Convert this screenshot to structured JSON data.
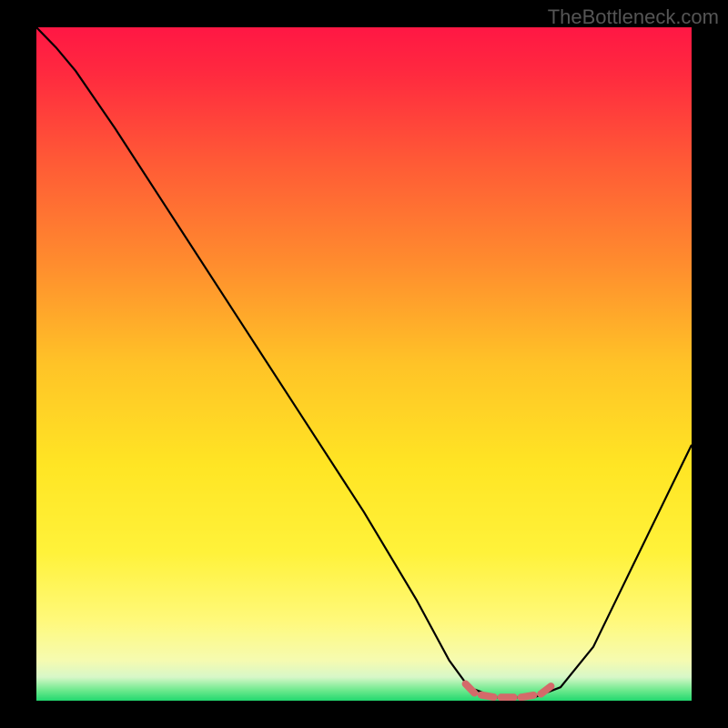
{
  "watermark": "TheBottleneck.com",
  "chart_data": {
    "type": "line",
    "title": "",
    "xlabel": "",
    "ylabel": "",
    "xlim": [
      0,
      100
    ],
    "ylim": [
      0,
      100
    ],
    "gradient_stops": [
      {
        "offset": 0.0,
        "color": "#ff1744"
      },
      {
        "offset": 0.07,
        "color": "#ff2a3f"
      },
      {
        "offset": 0.2,
        "color": "#ff5a36"
      },
      {
        "offset": 0.35,
        "color": "#ff8c2e"
      },
      {
        "offset": 0.5,
        "color": "#ffc327"
      },
      {
        "offset": 0.65,
        "color": "#ffe524"
      },
      {
        "offset": 0.78,
        "color": "#fff23a"
      },
      {
        "offset": 0.88,
        "color": "#fff97a"
      },
      {
        "offset": 0.94,
        "color": "#f6fbb0"
      },
      {
        "offset": 0.965,
        "color": "#d7f7c8"
      },
      {
        "offset": 0.985,
        "color": "#6be98c"
      },
      {
        "offset": 1.0,
        "color": "#22d86f"
      }
    ],
    "series": [
      {
        "name": "bottleneck-curve",
        "color": "#000000",
        "points": [
          {
            "x": 0.0,
            "y": 100.0
          },
          {
            "x": 3.0,
            "y": 97.0
          },
          {
            "x": 6.0,
            "y": 93.5
          },
          {
            "x": 12.0,
            "y": 85.0
          },
          {
            "x": 20.0,
            "y": 73.0
          },
          {
            "x": 30.0,
            "y": 58.0
          },
          {
            "x": 40.0,
            "y": 43.0
          },
          {
            "x": 50.0,
            "y": 28.0
          },
          {
            "x": 58.0,
            "y": 15.0
          },
          {
            "x": 63.0,
            "y": 6.0
          },
          {
            "x": 66.0,
            "y": 2.0
          },
          {
            "x": 70.0,
            "y": 0.5
          },
          {
            "x": 76.0,
            "y": 0.5
          },
          {
            "x": 80.0,
            "y": 2.0
          },
          {
            "x": 85.0,
            "y": 8.0
          },
          {
            "x": 90.0,
            "y": 18.0
          },
          {
            "x": 95.0,
            "y": 28.0
          },
          {
            "x": 100.0,
            "y": 38.0
          }
        ]
      },
      {
        "name": "optimal-range-marker",
        "color": "#d46a6a",
        "stroke_width": 8,
        "points": [
          {
            "x": 65.5,
            "y": 2.5
          },
          {
            "x": 67.0,
            "y": 1.0
          },
          {
            "x": 70.0,
            "y": 0.5
          },
          {
            "x": 74.0,
            "y": 0.5
          },
          {
            "x": 77.0,
            "y": 1.0
          },
          {
            "x": 79.0,
            "y": 2.5
          }
        ]
      }
    ]
  }
}
